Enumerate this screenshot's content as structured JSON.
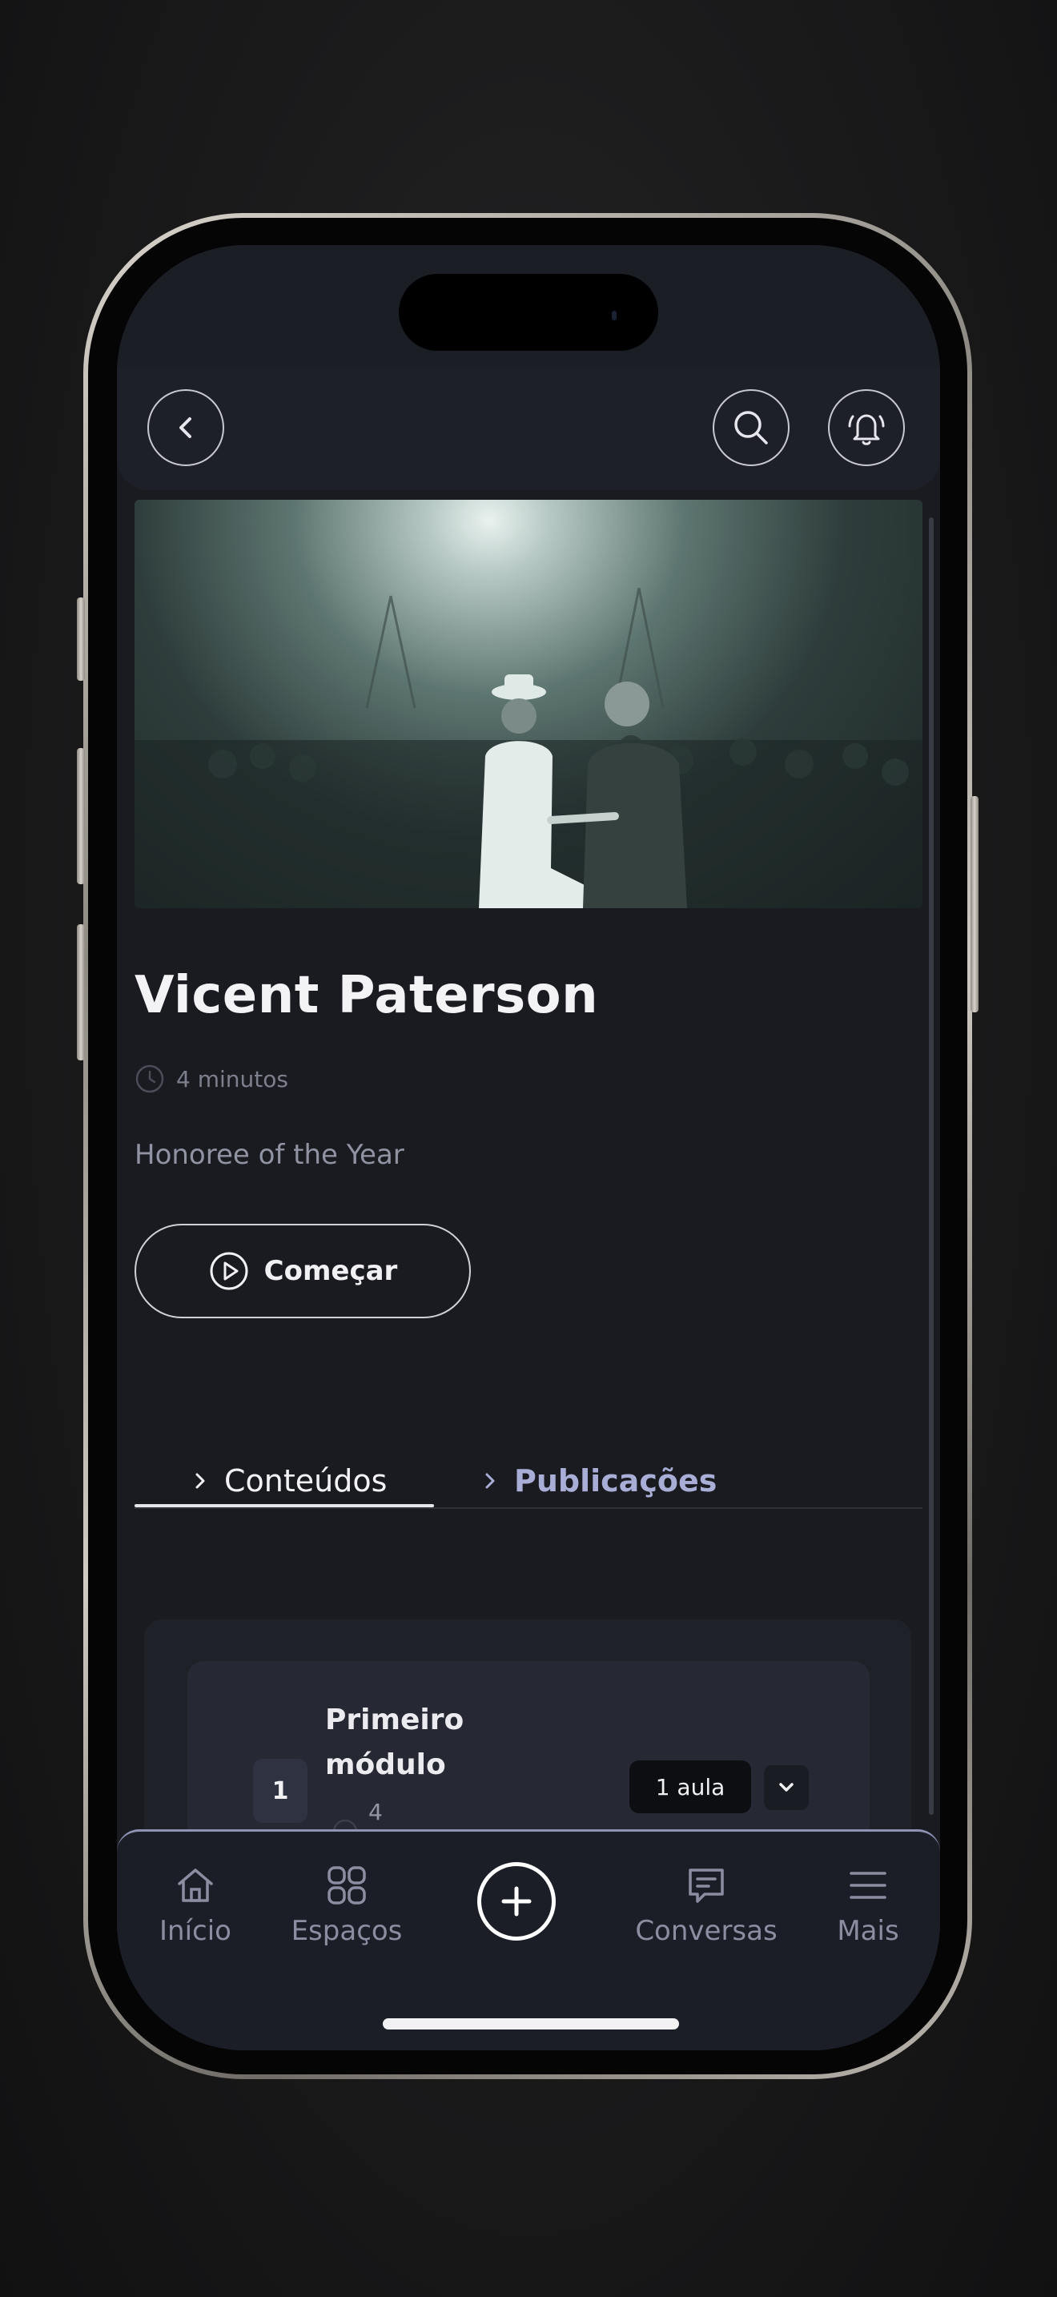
{
  "header": {
    "back_icon": "chevron-left-icon",
    "search_icon": "search-icon",
    "notifications_icon": "bell-ringing-icon"
  },
  "hero": {
    "description": "black-and-white photo"
  },
  "content": {
    "title": "Vicent Paterson",
    "duration": "4 minutos",
    "subtitle": "Honoree of the Year",
    "start_label": "Começar"
  },
  "tabs": [
    {
      "label": "Conteúdos",
      "active": true
    },
    {
      "label": "Publicações",
      "active": false
    }
  ],
  "module": {
    "number": "1",
    "title": "Primeiro módulo",
    "count": "4",
    "lessons": "1 aula"
  },
  "bottom_nav": [
    {
      "label": "Início",
      "icon": "home-icon"
    },
    {
      "label": "Espaços",
      "icon": "grid-icon"
    },
    {
      "label": "",
      "icon": "plus-circle-icon"
    },
    {
      "label": "Conversas",
      "icon": "chat-icon"
    },
    {
      "label": "Mais",
      "icon": "menu-icon"
    }
  ],
  "colors": {
    "background": "#1a1b21",
    "header": "#1e2029",
    "accent_inactive_tab": "#a9aed6",
    "nav_border": "#8f93b3"
  }
}
